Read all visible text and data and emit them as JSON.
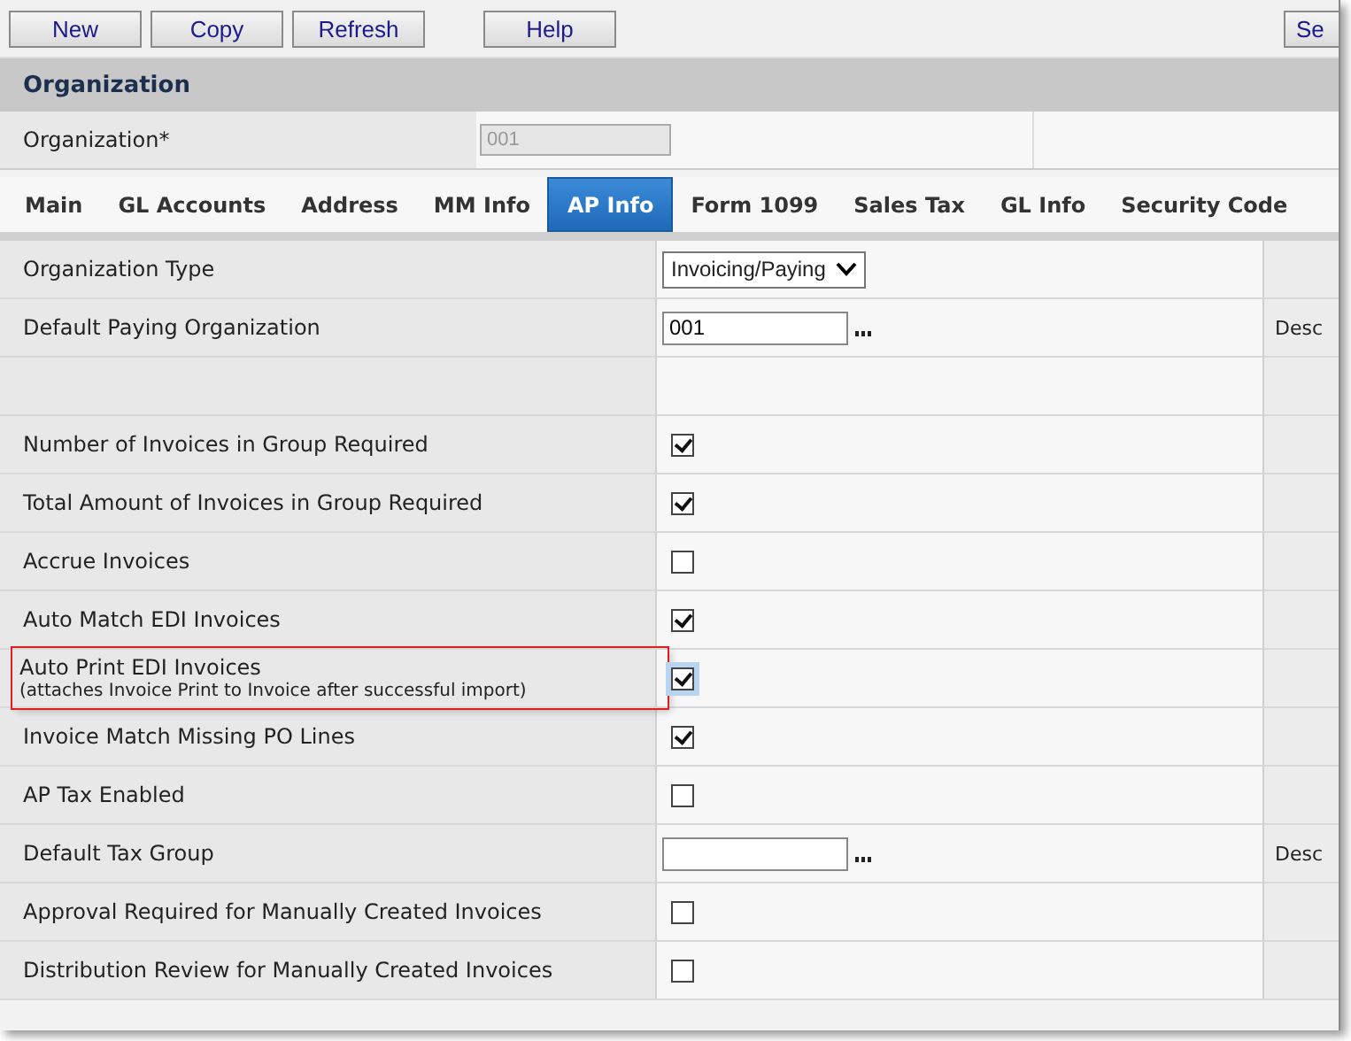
{
  "toolbar": {
    "buttons": [
      "New",
      "Copy",
      "Refresh",
      "Help",
      "Se"
    ]
  },
  "section": {
    "title": "Organization"
  },
  "organization": {
    "label": "Organization*",
    "value": "001",
    "disabled": true
  },
  "tabs": [
    {
      "label": "Main",
      "selected": false
    },
    {
      "label": "GL Accounts",
      "selected": false
    },
    {
      "label": "Address",
      "selected": false
    },
    {
      "label": "MM Info",
      "selected": false
    },
    {
      "label": "AP Info",
      "selected": true
    },
    {
      "label": "Form 1099",
      "selected": false
    },
    {
      "label": "Sales Tax",
      "selected": false
    },
    {
      "label": "GL Info",
      "selected": false
    },
    {
      "label": "Security Code",
      "selected": false
    }
  ],
  "rows": [
    {
      "kind": "select",
      "label": "Organization Type",
      "value": "Invoicing/Paying"
    },
    {
      "kind": "lookup",
      "label": "Default Paying Organization",
      "value": "001",
      "extra": "Desc"
    },
    {
      "kind": "blank"
    },
    {
      "kind": "checkbox",
      "label": "Number of Invoices in Group Required",
      "checked": true
    },
    {
      "kind": "checkbox",
      "label": "Total Amount of Invoices in Group Required",
      "checked": true
    },
    {
      "kind": "checkbox",
      "label": "Accrue Invoices",
      "checked": false
    },
    {
      "kind": "checkbox",
      "label": "Auto Match EDI Invoices",
      "checked": true
    },
    {
      "kind": "checkbox",
      "label": "Auto Print EDI Invoices",
      "note": "(attaches Invoice Print to Invoice after successful import)",
      "checked": true,
      "highlighted": true
    },
    {
      "kind": "checkbox",
      "label": "Invoice Match Missing PO Lines",
      "checked": true
    },
    {
      "kind": "checkbox",
      "label": "AP Tax Enabled",
      "checked": false
    },
    {
      "kind": "lookup",
      "label": "Default Tax Group",
      "extra": "Desc"
    },
    {
      "kind": "checkbox",
      "label": "Approval Required for Manually Created Invoices",
      "checked": false
    },
    {
      "kind": "checkbox",
      "label": "Distribution Review for Manually Created Invoices",
      "checked": false
    }
  ]
}
